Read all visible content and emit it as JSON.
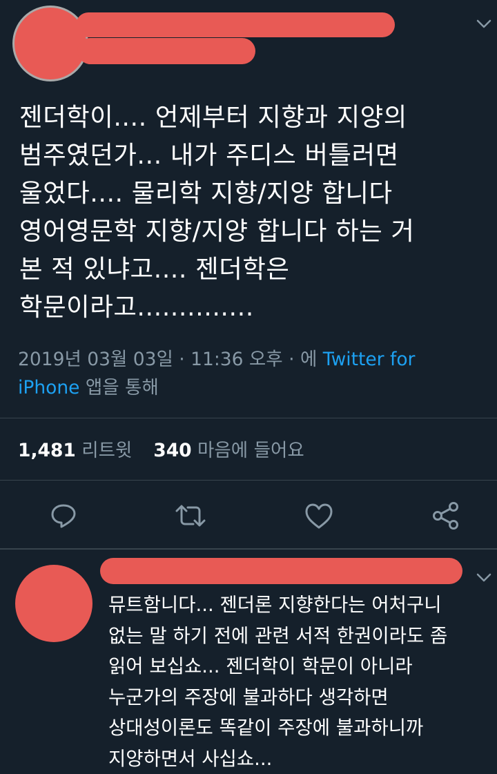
{
  "tweet": {
    "author_name": "",
    "author_handle": "",
    "text_lines": [
      "젠더학이.... 언제부터 지향과 지양의",
      "범주였던가... 내가 주디스 버틀러면",
      "울었다.... 물리학 지향/지양 합니다",
      "영어영문학 지향/지양 합니다 하는 거",
      "본 적 있냐고.... 젠더학은",
      "학문이라고.............."
    ],
    "timestamp": "2019년 03월 03일 · 11:36 오후 · 에 ",
    "source_link": "Twitter for iPhone",
    "source_suffix": " 앱을 통해",
    "retweet_count": "1,481",
    "retweet_label": "리트윗",
    "like_count": "340",
    "like_label": "마음에 들어요"
  },
  "reply": {
    "author_name": "",
    "text_lines": [
      "뮤트함니다... 젠더론 지향한다는 어처구니",
      "없는 말 하기 전에 관련 서적 한권이라도 좀",
      "읽어 보십쇼... 젠더학이 학문이 아니라",
      "누군가의 주장에 불과하다 생각하면",
      "상대성이론도 똑같이 주장에 불과하니까",
      "지양하면서 사십쇼..."
    ]
  },
  "icons": {
    "reply": "reply-icon",
    "retweet": "retweet-icon",
    "like": "heart-icon",
    "share": "share-icon",
    "more": "chevron-down-icon"
  },
  "colors": {
    "background": "#15202b",
    "secondary_text": "#8899a6",
    "link": "#1da1f2",
    "redaction": "#e85a55"
  }
}
